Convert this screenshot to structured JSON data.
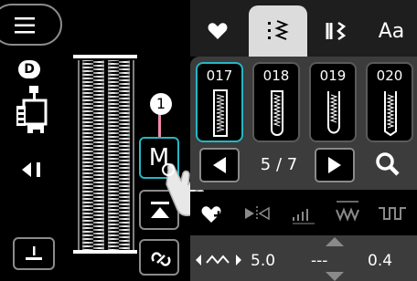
{
  "menu": {
    "icon": "menu-icon"
  },
  "presser_foot": {
    "code": "D"
  },
  "tabs": [
    {
      "icon": "heart-icon",
      "active": false
    },
    {
      "icon": "utility-stitch-icon",
      "active": true
    },
    {
      "icon": "decorative-stitch-icon",
      "active": false
    },
    {
      "label": "Aa",
      "active": false
    }
  ],
  "stitches": [
    {
      "number": "017",
      "selected": true
    },
    {
      "number": "018",
      "selected": false
    },
    {
      "number": "019",
      "selected": false
    },
    {
      "number": "020",
      "selected": false
    }
  ],
  "pager": {
    "text": "5 / 7"
  },
  "memory_button": {
    "label": "M"
  },
  "callout": {
    "number": "1"
  },
  "settings": {
    "width": "5.0",
    "dash": "---",
    "length": "0.4"
  },
  "colors": {
    "accent": "#26b6c4",
    "callout": "#f08aa8"
  }
}
